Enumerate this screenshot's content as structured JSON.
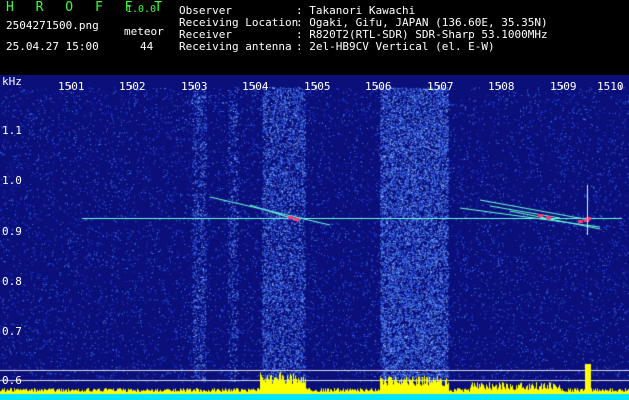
{
  "app": {
    "logo": "H R O F F T",
    "version": "1.0.0",
    "file": "2504271500.png",
    "datetime": "25.04.27 15:00",
    "meteor_label": "meteor",
    "meteor_count": "44"
  },
  "info": {
    "observer_label": "Observer",
    "observer_value": ": Takanori Kawachi",
    "location_label": "Receiving Location",
    "location_value": ": Ogaki, Gifu, JAPAN (136.60E, 35.35N)",
    "receiver_label": "Receiver",
    "receiver_value": ": R820T2(RTL-SDR) SDR-Sharp 53.1000MHz",
    "antenna_label": "Receiving antenna",
    "antenna_value": ": 2el-HB9CV Vertical (el. E-W)"
  },
  "spectrogram": {
    "y_unit": "kHz",
    "x_ticks": [
      "1501",
      "1502",
      "1503",
      "1504",
      "1505",
      "1506",
      "1507",
      "1508",
      "1509",
      "1510"
    ],
    "y_ticks": [
      "1.1",
      "1.0",
      "0.9",
      "0.8",
      "0.7",
      "0.6"
    ],
    "background_color": "#0a0f7a",
    "noise_color": "#3a6cff",
    "carrier_color": "#6dffd8",
    "echo_color": "#ff3a7a",
    "power_color": "#ffff00",
    "baseline_color": "#00e5ff"
  }
}
